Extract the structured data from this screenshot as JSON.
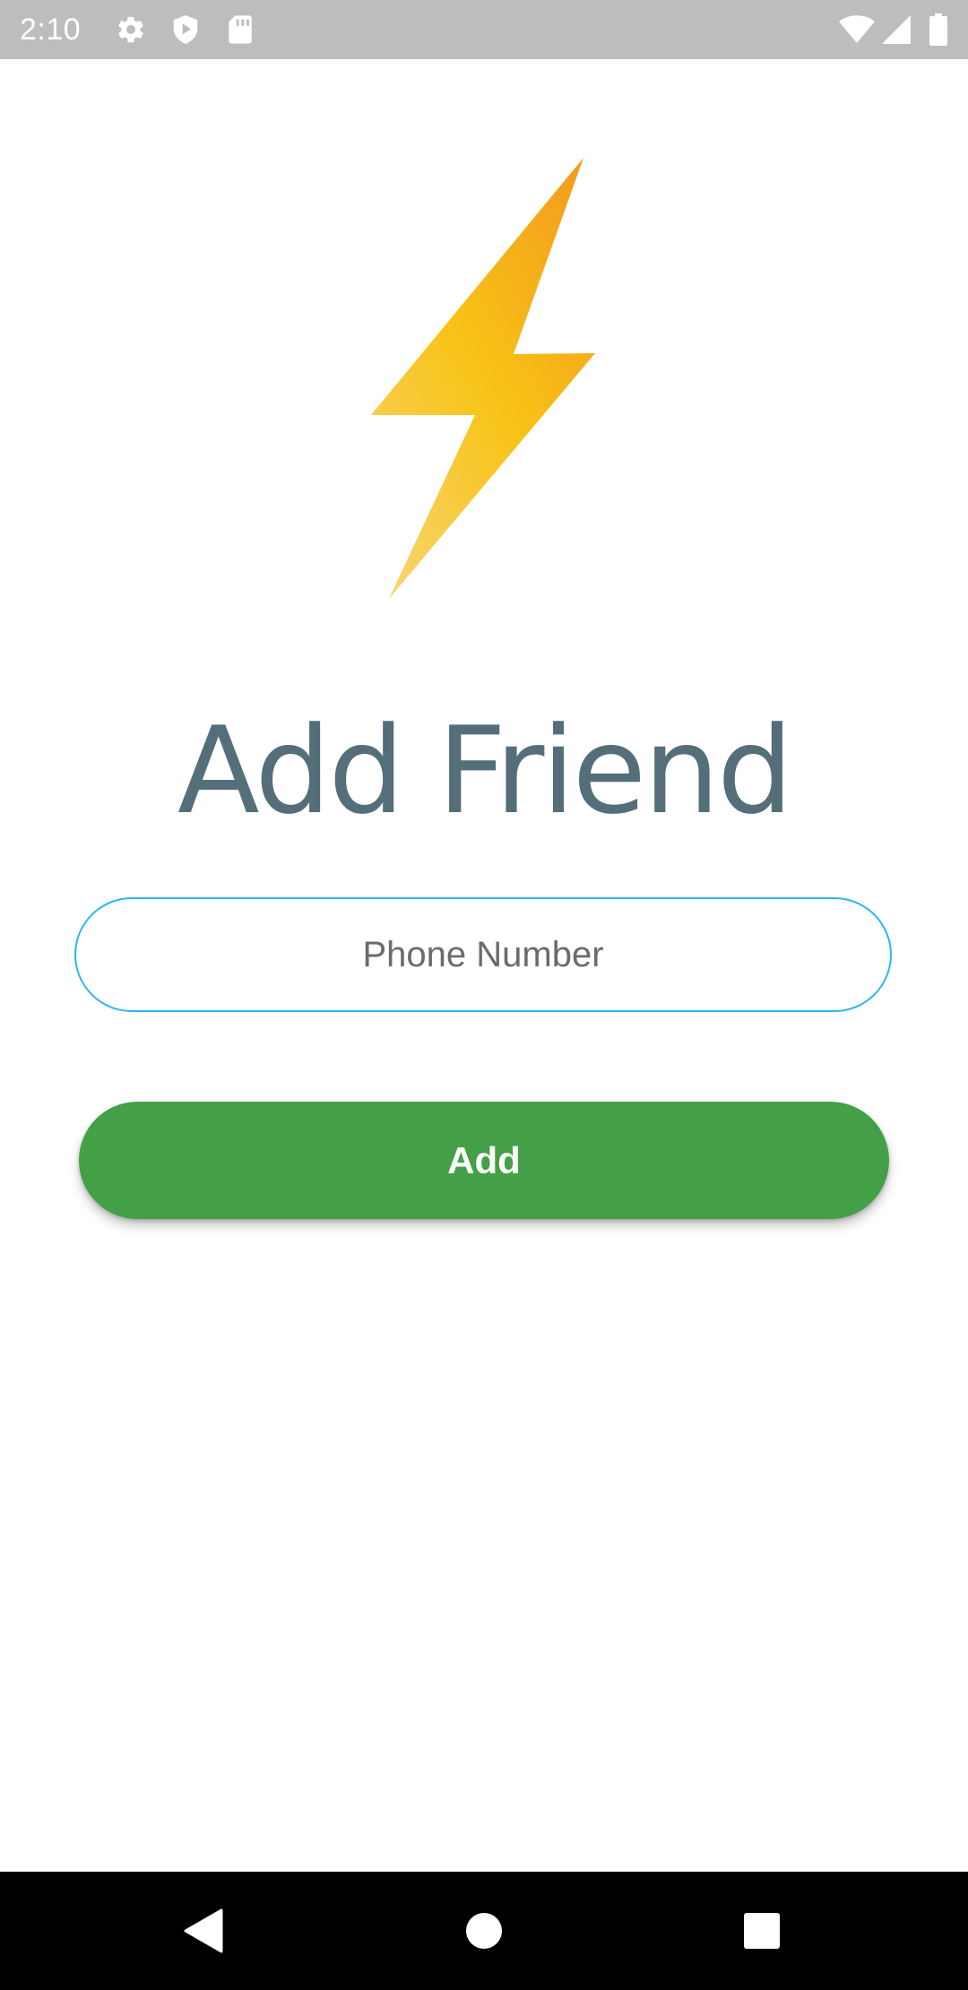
{
  "status_bar": {
    "time": "2:10",
    "left_icons": [
      "gear-icon",
      "shield-play-icon",
      "sd-card-icon"
    ],
    "right_icons": [
      "wifi-icon",
      "cell-signal-icon",
      "battery-icon"
    ]
  },
  "logo": {
    "icon": "lightning-bolt-icon",
    "colors": [
      "#f39c1f",
      "#f8c315",
      "#f7d46f"
    ]
  },
  "title": "Add Friend",
  "phone_input": {
    "placeholder": "Phone Number",
    "value": "",
    "border_color": "#29b6f6"
  },
  "add_button": {
    "label": "Add",
    "color": "#43a047"
  },
  "nav_bar": {
    "items": [
      "back-icon",
      "home-icon",
      "recents-icon"
    ]
  }
}
